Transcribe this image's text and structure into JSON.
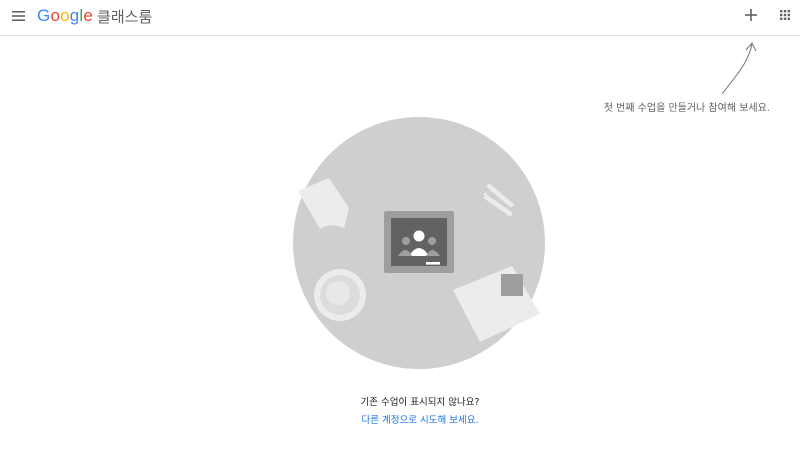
{
  "header": {
    "logo_letters": [
      "G",
      "o",
      "o",
      "g",
      "l",
      "e"
    ],
    "product_name": "클래스룸",
    "icons": {
      "menu": "menu-icon",
      "create_join": "plus-icon",
      "apps": "apps-grid-icon"
    }
  },
  "hint": {
    "text": "첫 번째 수업을 만들거나 참여해 보세요."
  },
  "empty_state": {
    "illustration": "classroom-table-illustration",
    "title": "기존 수업이 표시되지 않나요?",
    "link": "다른 계정으로 시도해 보세요."
  },
  "colors": {
    "google_blue": "#4285f4",
    "google_red": "#ea4335",
    "google_yellow": "#fbbc05",
    "google_green": "#34a853",
    "link_blue": "#1a73e8",
    "table_gray": "#cfcfcf",
    "icon_gray": "#5f6368"
  }
}
